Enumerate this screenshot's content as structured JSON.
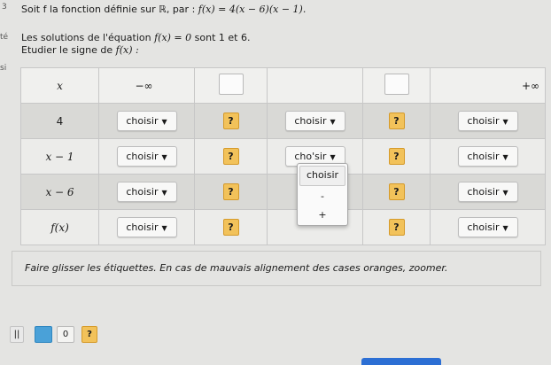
{
  "header": {
    "q_number": "3",
    "line1_text": "Soit f la fonction définie sur ℝ, par :",
    "line1_formula": "f(x) = 4(x − 6)(x − 1).",
    "line2_text": "Les solutions de l'équation",
    "line2_formula": "f(x) = 0",
    "line2_end": "sont 1 et 6.",
    "line3_text": "Etudier le signe de",
    "line3_formula": "f(x) :",
    "margin_frag1": "té",
    "margin_frag2": "si"
  },
  "table": {
    "header_row": {
      "label": "x",
      "minus_inf": "−∞",
      "plus_inf": "+∞"
    },
    "select_default": "choisir",
    "qmark": "?",
    "rows": [
      {
        "label": "4"
      },
      {
        "label": "x − 1"
      },
      {
        "label": "x − 6"
      },
      {
        "label": "f(x)"
      }
    ]
  },
  "dropdown": {
    "current": "cho'sir",
    "options": [
      "choisir",
      "-",
      "+"
    ]
  },
  "instruction": "Faire glisser les étiquettes. En cas de mauvais alignement des cases oranges, zoomer.",
  "toolbar": {
    "chip_bar": "||",
    "chip_zero": "0",
    "chip_q": "?"
  }
}
